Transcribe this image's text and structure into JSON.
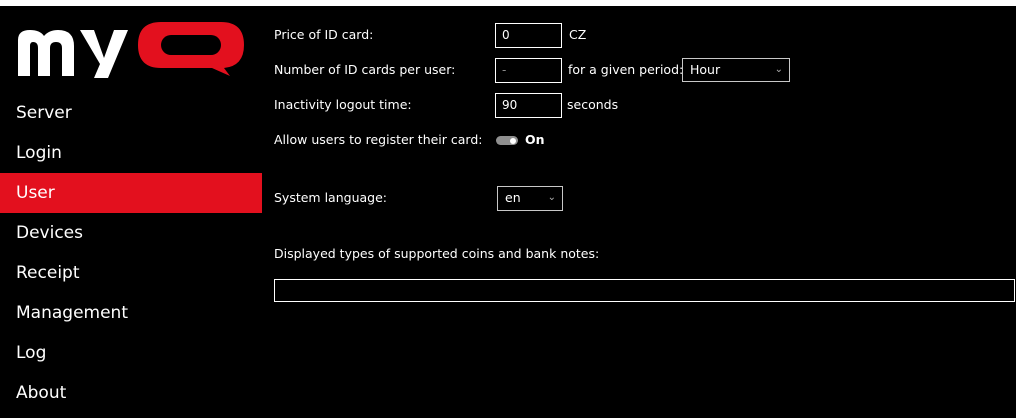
{
  "brand": {
    "logo_text": "myQ",
    "logo_color": "#e3101e"
  },
  "sidebar": {
    "accent_color": "#e3101e",
    "items": [
      {
        "label": "Server"
      },
      {
        "label": "Login"
      },
      {
        "label": "User",
        "active": true
      },
      {
        "label": "Devices"
      },
      {
        "label": "Receipt"
      },
      {
        "label": "Management"
      },
      {
        "label": "Log"
      },
      {
        "label": "About"
      }
    ]
  },
  "form": {
    "price_id_card": {
      "label": "Price of ID card:",
      "value": "0",
      "currency": "CZ"
    },
    "id_cards_per_user": {
      "label": "Number of ID cards per user:",
      "placeholder": "-",
      "period_label": "for a given period:",
      "period_value": "Hour"
    },
    "inactivity_logout": {
      "label": "Inactivity logout time:",
      "value": "90",
      "unit": "seconds"
    },
    "allow_register_card": {
      "label": "Allow users to register their card:",
      "state_text": "On",
      "enabled": true
    },
    "system_language": {
      "label": "System language:",
      "value": "en"
    },
    "coin_types": {
      "label": "Displayed types of supported coins and bank notes:",
      "value": ""
    }
  }
}
